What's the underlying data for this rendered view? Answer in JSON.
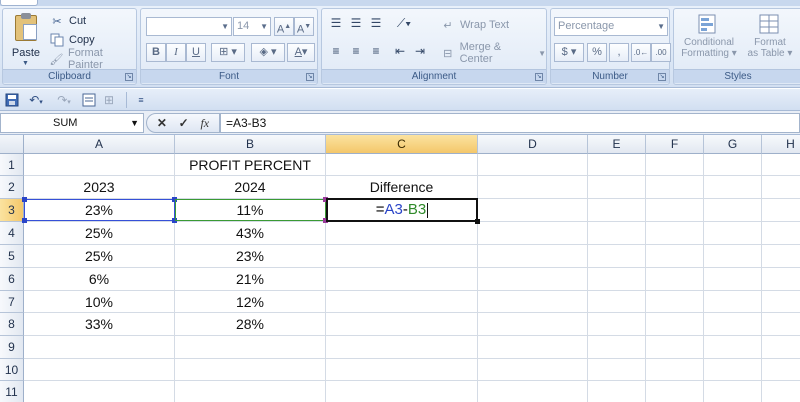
{
  "ribbon": {
    "clipboard": {
      "paste_label": "Paste",
      "cut_label": "Cut",
      "copy_label": "Copy",
      "format_painter_label": "Format Painter",
      "group_label": "Clipboard"
    },
    "font": {
      "font_name": "",
      "font_size": "14",
      "group_label": "Font"
    },
    "alignment": {
      "wrap_text_label": "Wrap Text",
      "merge_center_label": "Merge & Center",
      "group_label": "Alignment"
    },
    "number": {
      "format_value": "Percentage",
      "group_label": "Number"
    },
    "styles": {
      "conditional_line1": "Conditional",
      "conditional_line2": "Formatting",
      "format_table_line1": "Format",
      "format_table_line2": "as Table",
      "group_label": "Styles"
    }
  },
  "formula_bar": {
    "name_box": "SUM",
    "fx_label": "fx",
    "formula": "=A3-B3"
  },
  "sheet": {
    "columns": [
      "A",
      "B",
      "C",
      "D",
      "E",
      "F",
      "G",
      "H"
    ],
    "rows": [
      "1",
      "2",
      "3",
      "4",
      "5",
      "6",
      "7",
      "8",
      "9",
      "10",
      "11"
    ],
    "title": "PROFIT PERCENT",
    "headers": {
      "a": "2023",
      "b": "2024",
      "c": "Difference"
    },
    "values_a": [
      "23%",
      "25%",
      "25%",
      "6%",
      "10%",
      "33%"
    ],
    "values_b": [
      "11%",
      "43%",
      "23%",
      "21%",
      "12%",
      "28%"
    ],
    "edit": {
      "eq": "=",
      "ref1": "A3",
      "minus": "-",
      "ref2": "B3"
    }
  },
  "colors": {
    "ref_a": "#2a45c8",
    "ref_b": "#2f8a2a",
    "selected_header": "#f4c76a"
  }
}
